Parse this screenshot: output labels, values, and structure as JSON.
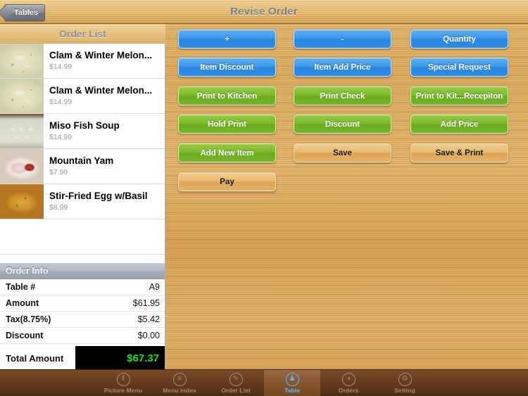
{
  "window": {
    "title": "Revise Order",
    "back_button": "Tables"
  },
  "left_panel": {
    "header": "Order List",
    "items": [
      {
        "name": "Clam & Winter Melon...",
        "price": "$14.99",
        "thumb": "clam-winter-melon-soup-photo"
      },
      {
        "name": "Clam & Winter Melon...",
        "price": "$14.99",
        "thumb": "clam-winter-melon-soup-photo"
      },
      {
        "name": "Miso Fish Soup",
        "price": "$14.99",
        "thumb": "miso-fish-soup-photo"
      },
      {
        "name": "Mountain Yam",
        "price": "$7.99",
        "thumb": "mountain-yam-photo"
      },
      {
        "name": "Stir-Fried Egg w/Basil",
        "price": "$8.99",
        "thumb": "stir-fried-egg-basil-photo"
      }
    ],
    "empty_rows": 2
  },
  "order_info": {
    "header": "Order Info",
    "rows": [
      {
        "label": "Table #",
        "value": "A9"
      },
      {
        "label": "Amount",
        "value": "$61.95"
      },
      {
        "label": "Tax(8.75%)",
        "value": "$5.42"
      },
      {
        "label": "Discount",
        "value": "$0.00"
      }
    ],
    "total_label": "Total Amount",
    "total_value": "$67.37",
    "total_value_color": "#16e016",
    "total_background": "#000000"
  },
  "actions": {
    "buttons": [
      {
        "label": "+",
        "style": "blue",
        "row": 0,
        "col": 0
      },
      {
        "label": "-",
        "style": "blue",
        "row": 0,
        "col": 1
      },
      {
        "label": "Quantity",
        "style": "blue",
        "row": 0,
        "col": 2
      },
      {
        "label": "Item Discount",
        "style": "blue",
        "row": 1,
        "col": 0
      },
      {
        "label": "Item Add Price",
        "style": "blue",
        "row": 1,
        "col": 1
      },
      {
        "label": "Special Request",
        "style": "blue",
        "row": 1,
        "col": 2
      },
      {
        "label": "Print to Kitchen",
        "style": "green",
        "row": 2,
        "col": 0
      },
      {
        "label": "Print Check",
        "style": "green",
        "row": 2,
        "col": 1
      },
      {
        "label": "Print to Kit...Recepiton",
        "style": "green",
        "row": 2,
        "col": 2
      },
      {
        "label": "Hold Print",
        "style": "green",
        "row": 3,
        "col": 0
      },
      {
        "label": "Discount",
        "style": "green",
        "row": 3,
        "col": 1
      },
      {
        "label": "Add Price",
        "style": "green",
        "row": 3,
        "col": 2
      },
      {
        "label": "Add New Item",
        "style": "green",
        "row": 4,
        "col": 0
      },
      {
        "label": "Save",
        "style": "tan",
        "row": 4,
        "col": 1
      },
      {
        "label": "Save & Print",
        "style": "tan",
        "row": 4,
        "col": 2
      },
      {
        "label": "Pay",
        "style": "tan",
        "row": 5,
        "col": 0
      }
    ]
  },
  "tabbar": {
    "tabs": [
      {
        "label": "Picture Menu",
        "icon": "utensils-icon",
        "glyph": "‖",
        "active": false
      },
      {
        "label": "Menu Index",
        "icon": "list-icon",
        "glyph": "≡",
        "active": false
      },
      {
        "label": "Order List",
        "icon": "edit-note-icon",
        "glyph": "✎",
        "active": false
      },
      {
        "label": "Table",
        "icon": "people-icon",
        "glyph": "♟",
        "active": true
      },
      {
        "label": "Orders",
        "icon": "book-icon",
        "glyph": "◑",
        "active": false
      },
      {
        "label": "Setting",
        "icon": "gear-icon",
        "glyph": "⚙",
        "active": false
      }
    ],
    "active_color": "#5fb8f0"
  },
  "theme": {
    "wood": "#dcab5f",
    "blue_button": "#3d96e8",
    "green_button": "#7cba2d",
    "tan_button": "#e8b96f"
  }
}
